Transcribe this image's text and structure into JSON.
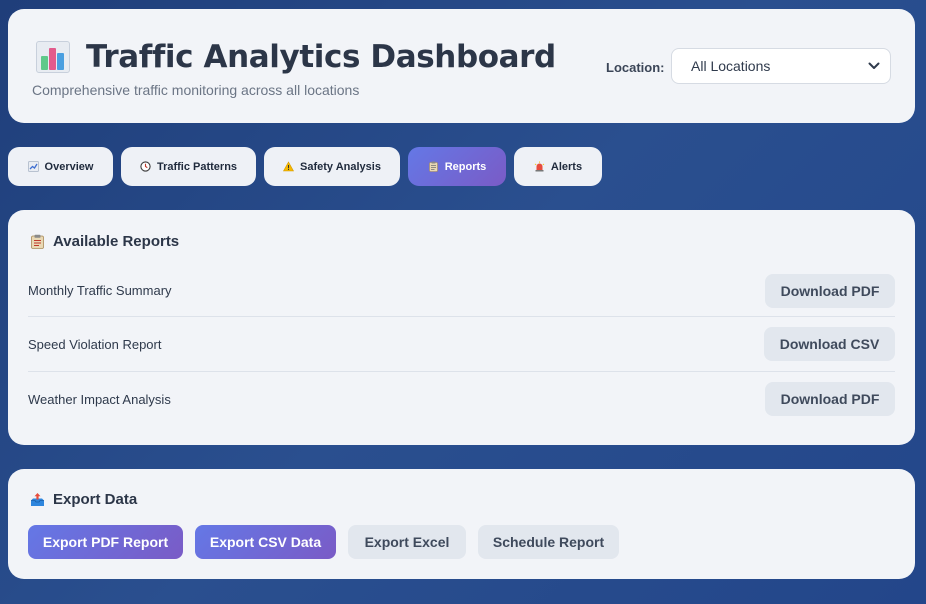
{
  "header": {
    "title": "Traffic Analytics Dashboard",
    "subtitle": "Comprehensive traffic monitoring across all locations",
    "logo_icon": "bar-chart-icon",
    "location_label": "Location:",
    "location_selected": "All Locations"
  },
  "tabs": [
    {
      "label": "Overview",
      "icon": "chart-increasing-icon",
      "active": false
    },
    {
      "label": "Traffic Patterns",
      "icon": "clock-icon",
      "active": false
    },
    {
      "label": "Safety Analysis",
      "icon": "warning-icon",
      "active": false
    },
    {
      "label": "Reports",
      "icon": "clipboard-icon",
      "active": true
    },
    {
      "label": "Alerts",
      "icon": "siren-icon",
      "active": false
    }
  ],
  "reports": {
    "title": "Available Reports",
    "icon": "clipboard-icon",
    "items": [
      {
        "name": "Monthly Traffic Summary",
        "action": "Download PDF"
      },
      {
        "name": "Speed Violation Report",
        "action": "Download CSV"
      },
      {
        "name": "Weather Impact Analysis",
        "action": "Download PDF"
      }
    ]
  },
  "export": {
    "title": "Export Data",
    "icon": "outbox-tray-icon",
    "buttons": [
      {
        "label": "Export PDF Report",
        "style": "primary"
      },
      {
        "label": "Export CSV Data",
        "style": "primary"
      },
      {
        "label": "Export Excel",
        "style": "secondary"
      },
      {
        "label": "Schedule Report",
        "style": "secondary"
      }
    ]
  },
  "colors": {
    "accent_start": "#6478e6",
    "accent_end": "#7a5bc6",
    "background": "#23468a"
  }
}
